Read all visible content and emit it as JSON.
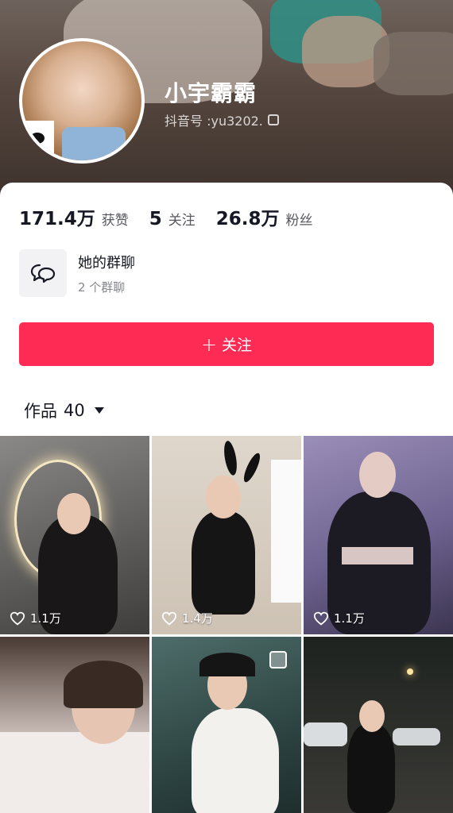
{
  "profile": {
    "name": "小宇霸霸",
    "douyin_id": "抖音号 :yu3202."
  },
  "stats": [
    {
      "value": "171.4万",
      "label": "获赞"
    },
    {
      "value": "5",
      "label": "关注"
    },
    {
      "value": "26.8万",
      "label": "粉丝"
    }
  ],
  "group_chat": {
    "title": "她的群聊",
    "subtitle": "2 个群聊"
  },
  "follow_button": {
    "label": "关注"
  },
  "works": {
    "label": "作品",
    "count": "40"
  },
  "videos": [
    {
      "likes": "1.1万"
    },
    {
      "likes": "1.4万"
    },
    {
      "likes": "1.1万"
    }
  ],
  "colors": {
    "accent": "#fe2c55"
  }
}
